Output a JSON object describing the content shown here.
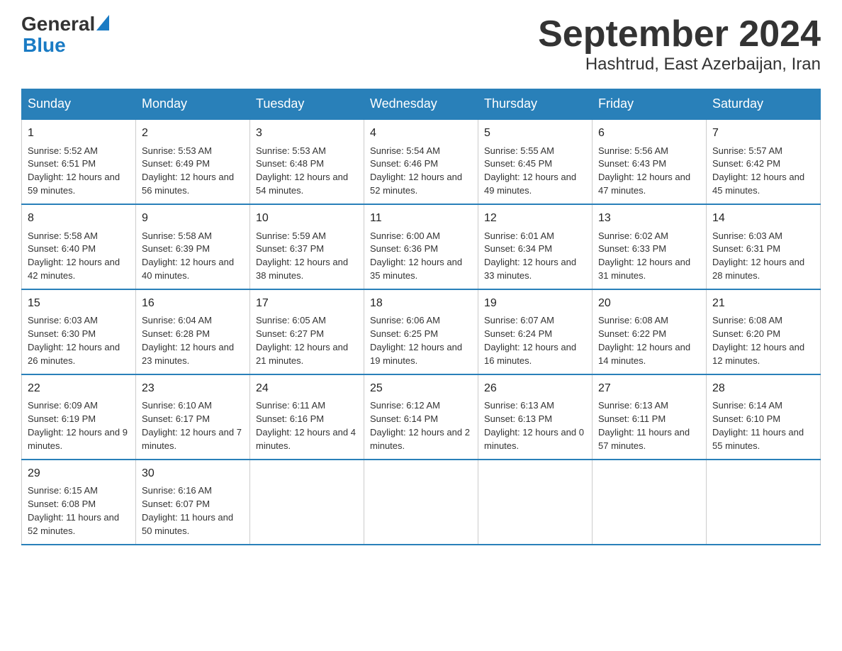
{
  "logo": {
    "text_general": "General",
    "text_blue": "Blue"
  },
  "title": "September 2024",
  "subtitle": "Hashtrud, East Azerbaijan, Iran",
  "weekdays": [
    "Sunday",
    "Monday",
    "Tuesday",
    "Wednesday",
    "Thursday",
    "Friday",
    "Saturday"
  ],
  "weeks": [
    [
      {
        "day": "1",
        "sunrise": "5:52 AM",
        "sunset": "6:51 PM",
        "daylight": "12 hours and 59 minutes."
      },
      {
        "day": "2",
        "sunrise": "5:53 AM",
        "sunset": "6:49 PM",
        "daylight": "12 hours and 56 minutes."
      },
      {
        "day": "3",
        "sunrise": "5:53 AM",
        "sunset": "6:48 PM",
        "daylight": "12 hours and 54 minutes."
      },
      {
        "day": "4",
        "sunrise": "5:54 AM",
        "sunset": "6:46 PM",
        "daylight": "12 hours and 52 minutes."
      },
      {
        "day": "5",
        "sunrise": "5:55 AM",
        "sunset": "6:45 PM",
        "daylight": "12 hours and 49 minutes."
      },
      {
        "day": "6",
        "sunrise": "5:56 AM",
        "sunset": "6:43 PM",
        "daylight": "12 hours and 47 minutes."
      },
      {
        "day": "7",
        "sunrise": "5:57 AM",
        "sunset": "6:42 PM",
        "daylight": "12 hours and 45 minutes."
      }
    ],
    [
      {
        "day": "8",
        "sunrise": "5:58 AM",
        "sunset": "6:40 PM",
        "daylight": "12 hours and 42 minutes."
      },
      {
        "day": "9",
        "sunrise": "5:58 AM",
        "sunset": "6:39 PM",
        "daylight": "12 hours and 40 minutes."
      },
      {
        "day": "10",
        "sunrise": "5:59 AM",
        "sunset": "6:37 PM",
        "daylight": "12 hours and 38 minutes."
      },
      {
        "day": "11",
        "sunrise": "6:00 AM",
        "sunset": "6:36 PM",
        "daylight": "12 hours and 35 minutes."
      },
      {
        "day": "12",
        "sunrise": "6:01 AM",
        "sunset": "6:34 PM",
        "daylight": "12 hours and 33 minutes."
      },
      {
        "day": "13",
        "sunrise": "6:02 AM",
        "sunset": "6:33 PM",
        "daylight": "12 hours and 31 minutes."
      },
      {
        "day": "14",
        "sunrise": "6:03 AM",
        "sunset": "6:31 PM",
        "daylight": "12 hours and 28 minutes."
      }
    ],
    [
      {
        "day": "15",
        "sunrise": "6:03 AM",
        "sunset": "6:30 PM",
        "daylight": "12 hours and 26 minutes."
      },
      {
        "day": "16",
        "sunrise": "6:04 AM",
        "sunset": "6:28 PM",
        "daylight": "12 hours and 23 minutes."
      },
      {
        "day": "17",
        "sunrise": "6:05 AM",
        "sunset": "6:27 PM",
        "daylight": "12 hours and 21 minutes."
      },
      {
        "day": "18",
        "sunrise": "6:06 AM",
        "sunset": "6:25 PM",
        "daylight": "12 hours and 19 minutes."
      },
      {
        "day": "19",
        "sunrise": "6:07 AM",
        "sunset": "6:24 PM",
        "daylight": "12 hours and 16 minutes."
      },
      {
        "day": "20",
        "sunrise": "6:08 AM",
        "sunset": "6:22 PM",
        "daylight": "12 hours and 14 minutes."
      },
      {
        "day": "21",
        "sunrise": "6:08 AM",
        "sunset": "6:20 PM",
        "daylight": "12 hours and 12 minutes."
      }
    ],
    [
      {
        "day": "22",
        "sunrise": "6:09 AM",
        "sunset": "6:19 PM",
        "daylight": "12 hours and 9 minutes."
      },
      {
        "day": "23",
        "sunrise": "6:10 AM",
        "sunset": "6:17 PM",
        "daylight": "12 hours and 7 minutes."
      },
      {
        "day": "24",
        "sunrise": "6:11 AM",
        "sunset": "6:16 PM",
        "daylight": "12 hours and 4 minutes."
      },
      {
        "day": "25",
        "sunrise": "6:12 AM",
        "sunset": "6:14 PM",
        "daylight": "12 hours and 2 minutes."
      },
      {
        "day": "26",
        "sunrise": "6:13 AM",
        "sunset": "6:13 PM",
        "daylight": "12 hours and 0 minutes."
      },
      {
        "day": "27",
        "sunrise": "6:13 AM",
        "sunset": "6:11 PM",
        "daylight": "11 hours and 57 minutes."
      },
      {
        "day": "28",
        "sunrise": "6:14 AM",
        "sunset": "6:10 PM",
        "daylight": "11 hours and 55 minutes."
      }
    ],
    [
      {
        "day": "29",
        "sunrise": "6:15 AM",
        "sunset": "6:08 PM",
        "daylight": "11 hours and 52 minutes."
      },
      {
        "day": "30",
        "sunrise": "6:16 AM",
        "sunset": "6:07 PM",
        "daylight": "11 hours and 50 minutes."
      },
      null,
      null,
      null,
      null,
      null
    ]
  ]
}
